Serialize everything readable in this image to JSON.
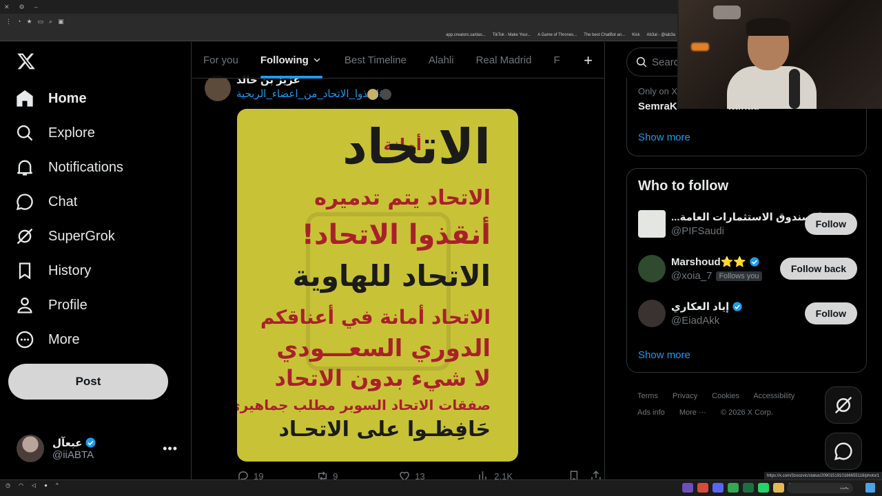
{
  "browser": {
    "bookmarks": [
      "app.creators.sa/das...",
      "TikTok - Make Your...",
      "A Game of Thrones...",
      "The best ChatBot an...",
      "Kick",
      "Ab3al - @iab3a"
    ],
    "status_url": "https://x.com/3zoozvic/status/2090151910166655118/photo/1"
  },
  "nav": {
    "items": [
      {
        "label": "Home",
        "icon": "home-icon"
      },
      {
        "label": "Explore",
        "icon": "search-icon"
      },
      {
        "label": "Notifications",
        "icon": "bell-icon"
      },
      {
        "label": "Chat",
        "icon": "chat-bubble-icon"
      },
      {
        "label": "SuperGrok",
        "icon": "grok-icon"
      },
      {
        "label": "History",
        "icon": "bookmark-icon"
      },
      {
        "label": "Profile",
        "icon": "person-icon"
      },
      {
        "label": "More",
        "icon": "more-circle-icon"
      }
    ],
    "post_label": "Post",
    "account": {
      "name": "عبعآل",
      "handle": "@iiABTA",
      "more": "•••"
    }
  },
  "tabs": [
    "For you",
    "Following",
    "Best Timeline",
    "Alahli",
    "Real Madrid",
    "F"
  ],
  "tweet": {
    "author_name": "عزيز بن خالد",
    "hashtag": "#انقذوا_الاتحاد_من_اعضاء_الربحية",
    "poster_lines": [
      "أمانة",
      "الاتحاد",
      "الاتحاد يتم تدميره",
      "أنقذوا الاتحاد!",
      "الاتحاد للهاوية",
      "الاتحاد أمانة في أعناقكم",
      "الدوري السعـــودي",
      "لا شيء بدون الاتحاد",
      "صفقات الاتحاد السوبر مطلب جماهيري",
      "حَافِظـوا على الاتحـاد"
    ],
    "replies": "19",
    "reposts": "9",
    "likes": "13",
    "views": "2.1K"
  },
  "right": {
    "search_placeholder": "Search",
    "trend_meta": "Only on X",
    "trend_name": "SemraK",
    "trend_name_suffix": "Ittihad",
    "show_more": "Show more",
    "who_to_follow": "Who to follow",
    "suggestions": [
      {
        "name": "...صندوق الاستثمارات العامة",
        "handle": "@PIFSaudi",
        "button": "Follow",
        "follows_you": ""
      },
      {
        "name": "Marshoud⭐⭐",
        "handle": "@xoia_7",
        "button": "Follow back",
        "follows_you": "Follows you"
      },
      {
        "name": "إياد العكاري",
        "handle": "@EiadAkk",
        "button": "Follow",
        "follows_you": ""
      }
    ],
    "footer": [
      "Terms",
      "Privacy",
      "Cookies",
      "Accessibility",
      "Ads info",
      "More ···",
      "© 2026 X Corp."
    ]
  },
  "taskbar": {
    "search_label": "بحث"
  }
}
